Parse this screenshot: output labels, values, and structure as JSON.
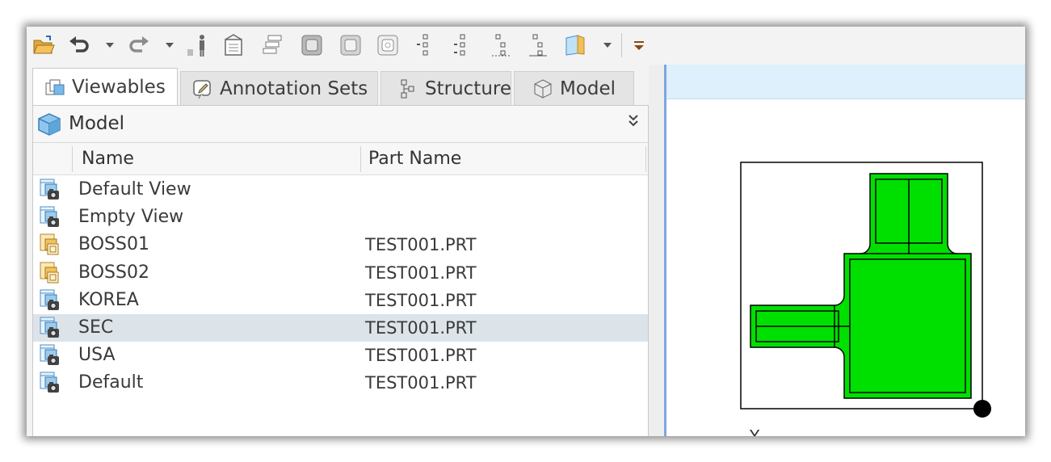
{
  "toolbar": {
    "buttons": [
      {
        "name": "open-folder-icon"
      },
      {
        "name": "undo-icon"
      },
      {
        "name": "redo-icon"
      },
      {
        "name": "person-icon"
      },
      {
        "name": "view-manager-icon"
      },
      {
        "name": "layers-icon"
      },
      {
        "name": "shaded-view-icon"
      },
      {
        "name": "hidden-line-icon"
      },
      {
        "name": "wireframe-icon"
      },
      {
        "name": "tree-icon"
      },
      {
        "name": "box-icon"
      },
      {
        "name": "more-icon"
      }
    ]
  },
  "tabs": [
    {
      "label": "Viewables",
      "active": true
    },
    {
      "label": "Annotation Sets",
      "active": false
    },
    {
      "label": "Structure",
      "active": false
    },
    {
      "label": "Model",
      "active": false
    }
  ],
  "model_bar": {
    "label": "Model"
  },
  "table": {
    "columns": [
      "Name",
      "Part Name"
    ],
    "rows": [
      {
        "name": "Default View",
        "part": "",
        "icon": "camera-view-icon",
        "selected": false
      },
      {
        "name": "Empty View",
        "part": "",
        "icon": "camera-view-icon",
        "selected": false
      },
      {
        "name": "BOSS01",
        "part": "TEST001.PRT",
        "icon": "layer-state-icon",
        "selected": false
      },
      {
        "name": "BOSS02",
        "part": "TEST001.PRT",
        "icon": "layer-state-icon",
        "selected": false
      },
      {
        "name": "KOREA",
        "part": "TEST001.PRT",
        "icon": "camera-view-icon",
        "selected": false
      },
      {
        "name": "SEC",
        "part": "TEST001.PRT",
        "icon": "camera-view-icon",
        "selected": true
      },
      {
        "name": "USA",
        "part": "TEST001.PRT",
        "icon": "camera-view-icon",
        "selected": false
      },
      {
        "name": "Default",
        "part": "TEST001.PRT",
        "icon": "camera-view-icon",
        "selected": false
      }
    ]
  },
  "viewport": {
    "axis_label": "Y",
    "fill_color": "#00e000",
    "header_color": "#ddf0fb"
  }
}
